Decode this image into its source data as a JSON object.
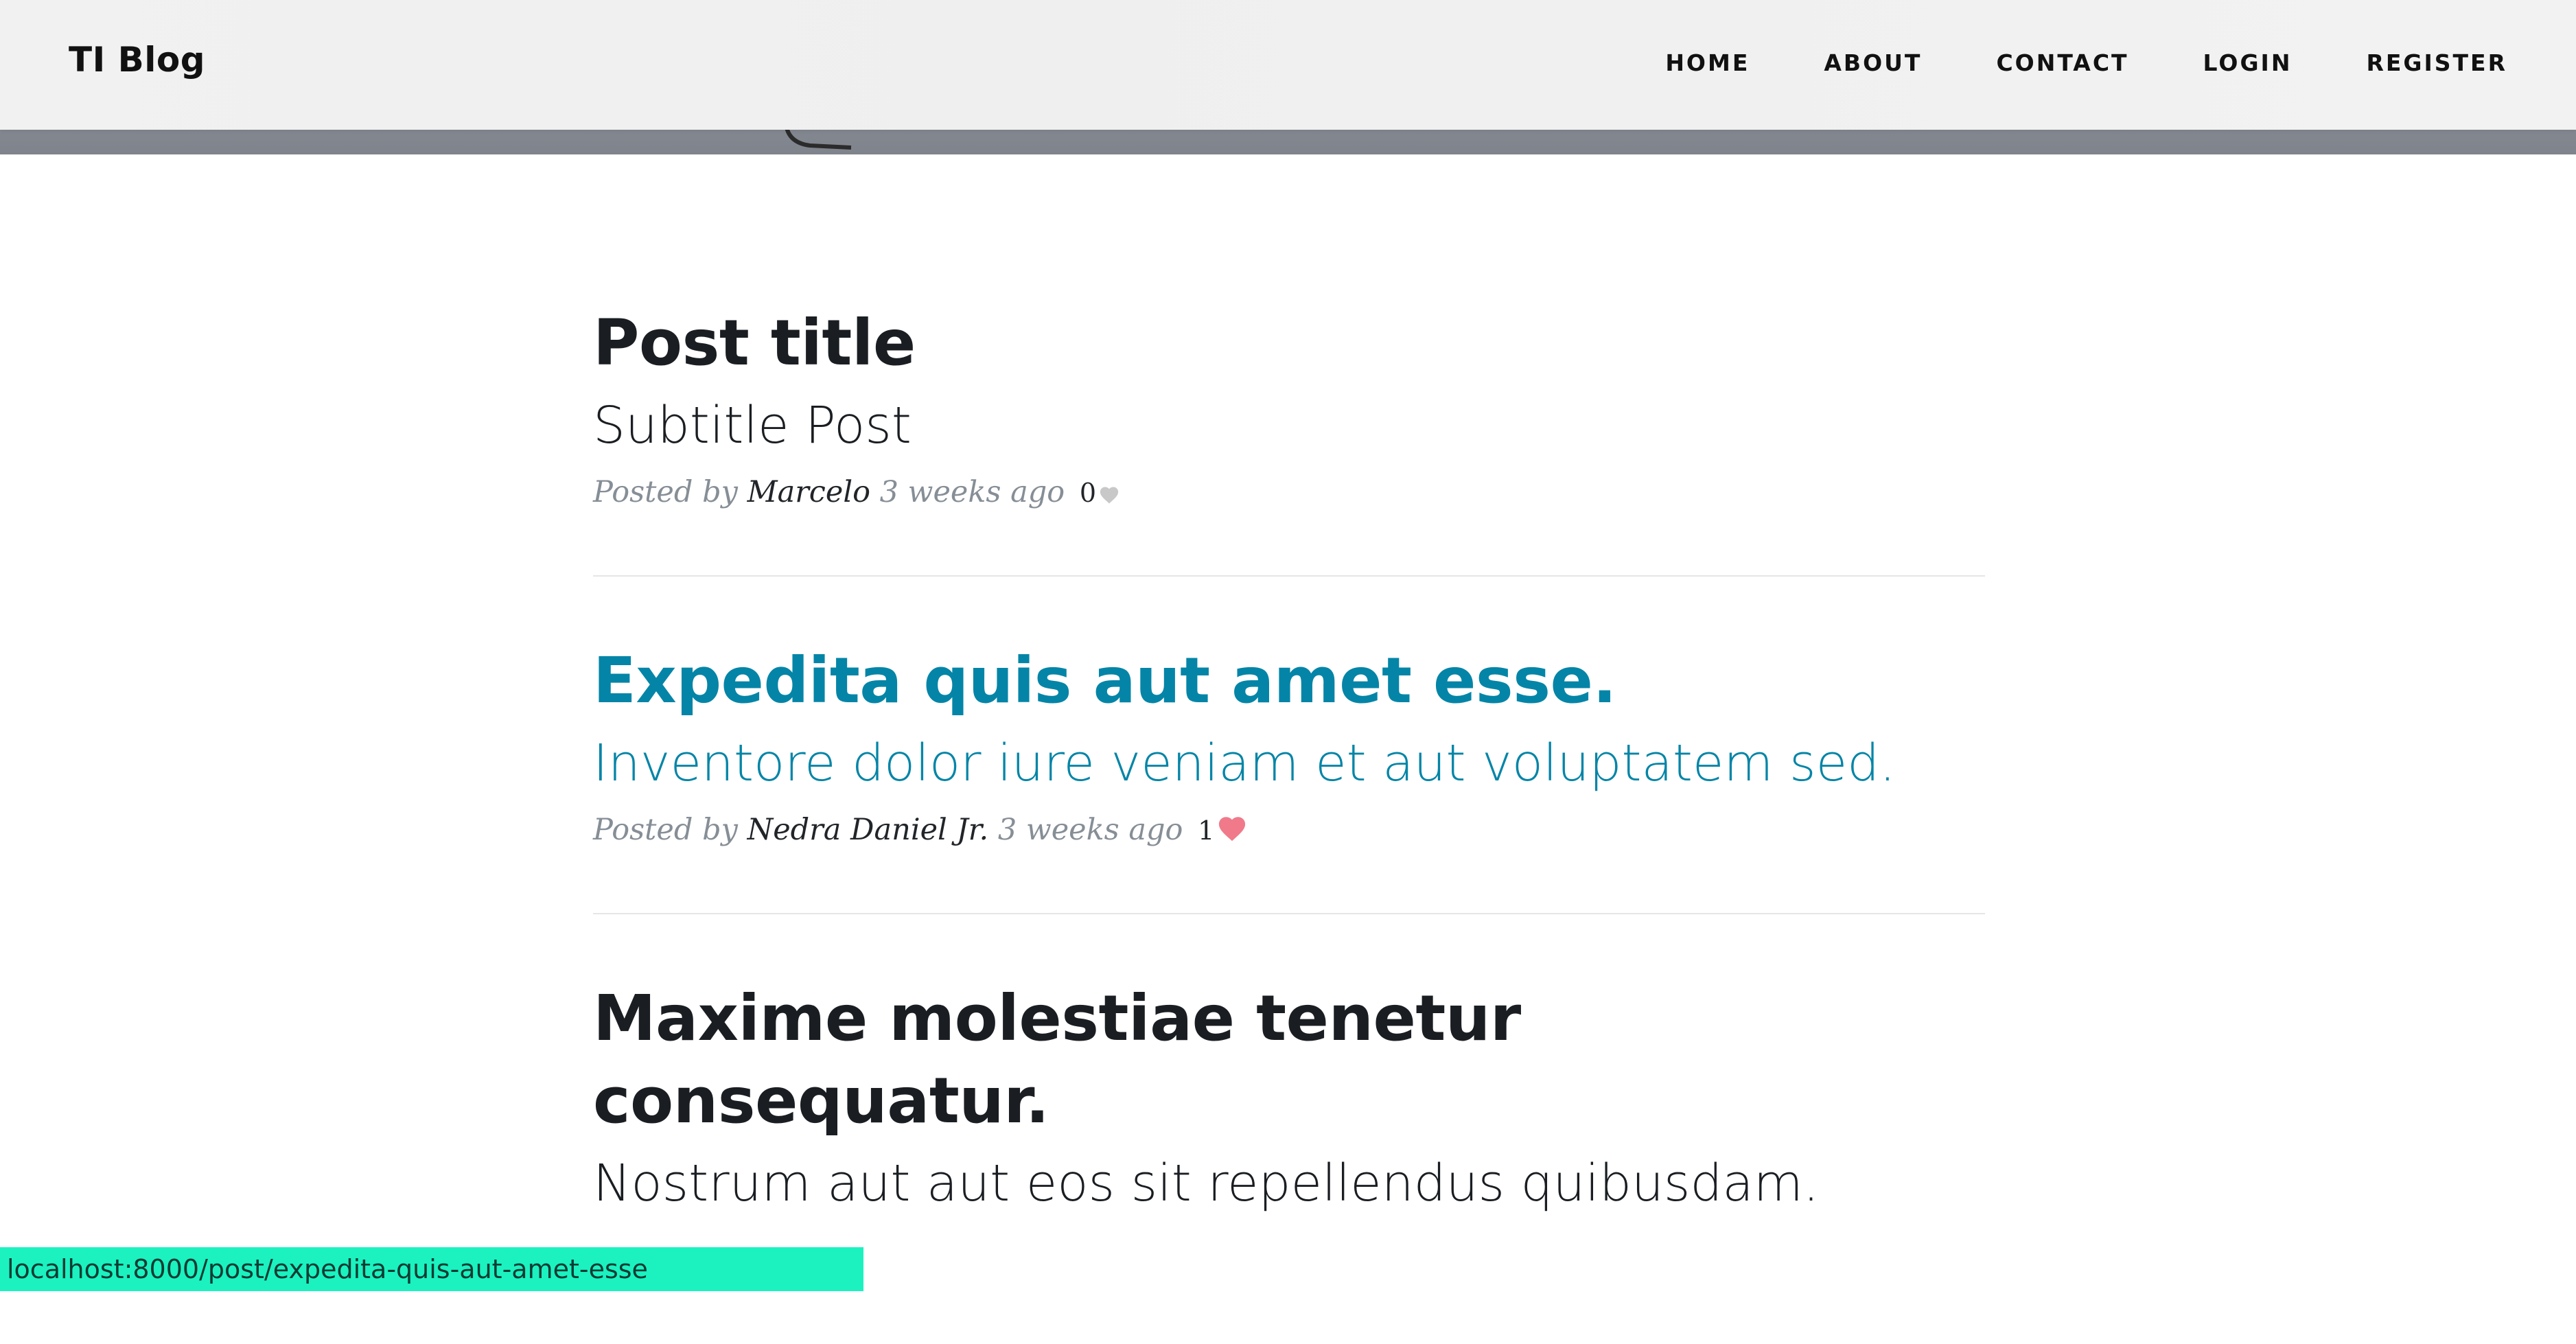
{
  "navbar": {
    "brand": "TI Blog",
    "links": [
      {
        "label": "HOME"
      },
      {
        "label": "ABOUT"
      },
      {
        "label": "CONTACT"
      },
      {
        "label": "LOGIN"
      },
      {
        "label": "REGISTER"
      }
    ]
  },
  "posts": [
    {
      "title": "Post title",
      "subtitle": "Subtitle Post",
      "posted_by_label": "Posted by",
      "author": "Marcelo",
      "time": "3 weeks ago",
      "likes": "0",
      "liked": false
    },
    {
      "title": "Expedita quis aut amet esse.",
      "subtitle": "Inventore dolor iure veniam et aut voluptatem sed.",
      "posted_by_label": "Posted by",
      "author": "Nedra Daniel Jr.",
      "time": "3 weeks ago",
      "likes": "1",
      "liked": true
    },
    {
      "title": "Maxime molestiae tenetur consequatur.",
      "subtitle": "Nostrum aut aut eos sit repellendus quibusdam."
    }
  ],
  "status_bar": {
    "url": "localhost:8000/post/expedita-quis-aut-amet-esse"
  },
  "colors": {
    "link_hover": "#0485a7",
    "heart_liked": "#f07a8a",
    "heart_unliked": "#c8c8c8",
    "status_bar_bg": "#1bf2c0"
  }
}
